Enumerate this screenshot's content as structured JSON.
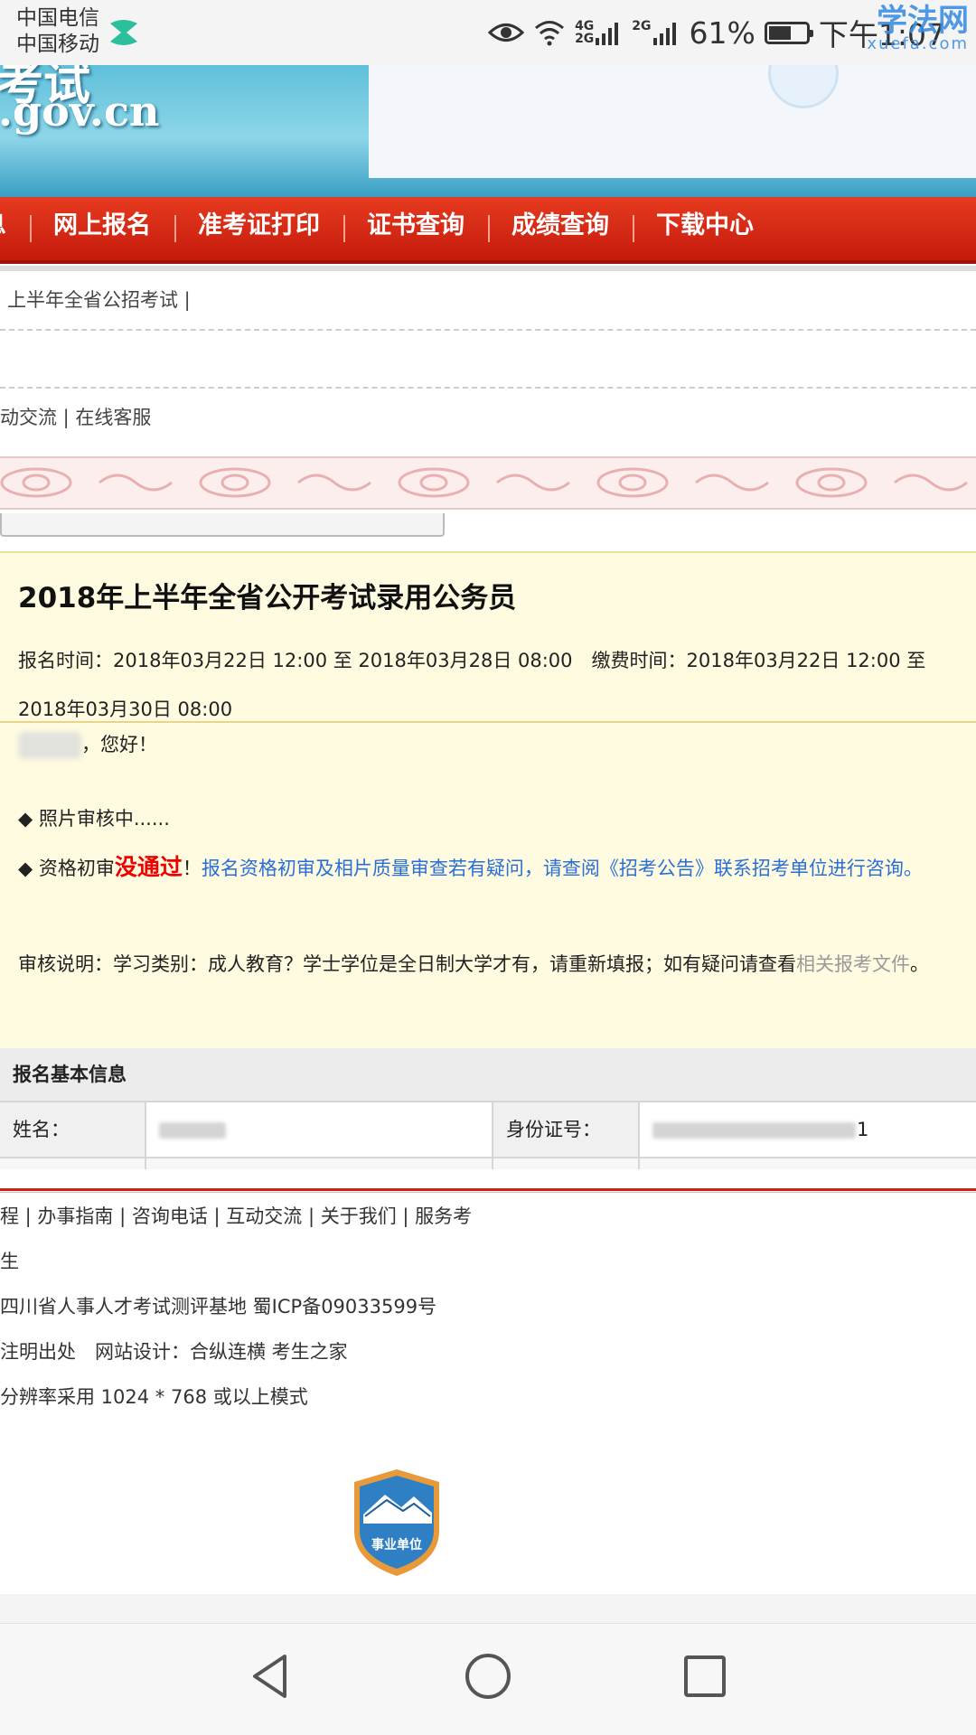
{
  "status_bar": {
    "carrier_1": "中国电信",
    "carrier_2": "中国移动",
    "net_1": "4G",
    "net_2": "2G",
    "net_3": "2G",
    "battery_pct": "61%",
    "battery_level": 0.61,
    "time": "下午1:07",
    "watermark_main": "学法网",
    "watermark_sub": "xuefa.com"
  },
  "banner": {
    "title_fragment": "考试",
    "domain_fragment": ".gov.cn"
  },
  "nav": {
    "items": [
      "息",
      "网上报名",
      "准考证打印",
      "证书查询",
      "成绩查询",
      "下载中心"
    ]
  },
  "notice": {
    "text": "上半年全省公招考试 |"
  },
  "links": {
    "text": "动交流 | 在线客服"
  },
  "exam": {
    "title": "2018年上半年全省公开考试录用公务员",
    "time_line": "报名时间：2018年03月22日 12:00 至 2018年03月28日 08:00　缴费时间：2018年03月22日 12:00 至 2018年03月30日 08:00"
  },
  "message": {
    "greeting_suffix": "，您好！",
    "photo_status": "◆ 照片审核中......",
    "qual_prefix": "◆ 资格初审",
    "qual_fail": "没通过",
    "qual_bang": "！",
    "qual_link": "报名资格初审及相片质量审查若有疑问，请查阅《招考公告》联系招考单位进行咨询。",
    "review_text": "审核说明：学习类别：成人教育？学士学位是全日制大学才有，请重新填报；如有疑问请查看",
    "review_link": "相关报考文件",
    "review_end": "。"
  },
  "table": {
    "header": "报名基本信息",
    "name_label": "姓名：",
    "id_label": "身份证号：",
    "id_tail": "1"
  },
  "footer": {
    "line_1": "程 | 办事指南 | 咨询电话 | 互动交流 | 关于我们 | 服务考",
    "line_2": "生",
    "line_3": "四川省人事人才考试测评基地 蜀ICP备09033599号",
    "line_4": "注明出处　网站设计：合纵连横 考生之家",
    "line_5": "分辨率采用 1024 * 768 或以上模式",
    "seal_text": "事业单位"
  },
  "colors": {
    "nav_red": "#c51a0c",
    "fail_red": "#ee0000",
    "link_blue": "#2a6fd6",
    "info_bg": "#fffbe0"
  },
  "icons": [
    "eye-icon",
    "wifi-icon",
    "signal-icon",
    "battery-icon",
    "back-icon",
    "home-icon",
    "recents-icon"
  ]
}
